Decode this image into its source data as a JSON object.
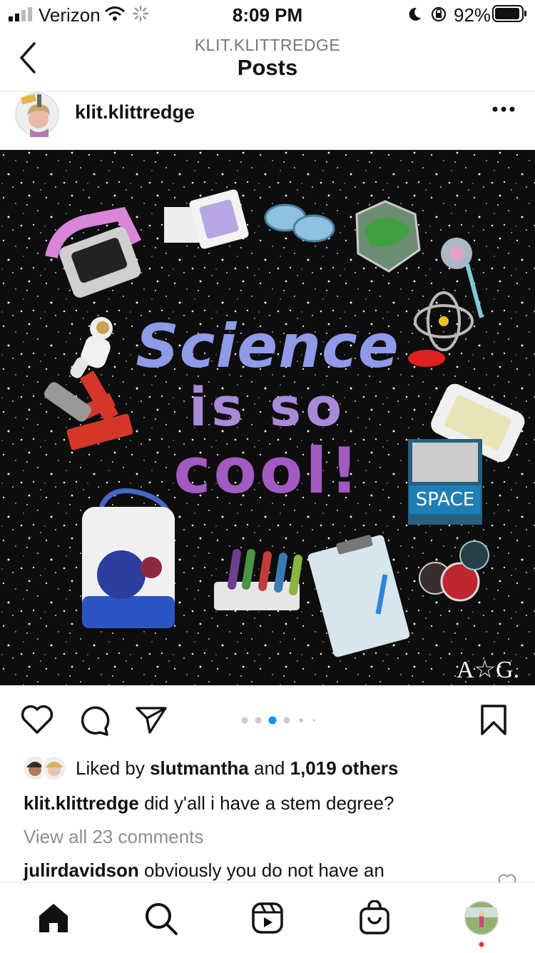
{
  "status_bar": {
    "carrier": "Verizon",
    "time": "8:09 PM",
    "battery": "92%"
  },
  "header": {
    "subtitle": "KLIT.KLITTREDGE",
    "title": "Posts"
  },
  "post": {
    "username": "klit.klittredge",
    "image_text": {
      "line1": "Science",
      "line2": "is so",
      "line3": "cool!",
      "book_title": "SPACE",
      "brand": "A☆G."
    },
    "likes": {
      "prefix": "Liked by",
      "user": "slutmantha",
      "middle": "and",
      "count": "1,019 others"
    },
    "caption": {
      "user": "klit.klittredge",
      "text": "did y'all i have a stem degree?"
    },
    "view_comments": "View all 23 comments",
    "comment": {
      "user": "julirdavidson",
      "text": "obviously you do not have an"
    },
    "carousel": {
      "count": 5,
      "active": 3
    }
  },
  "nav": {
    "items": [
      "home",
      "search",
      "reels",
      "shop",
      "profile"
    ]
  },
  "colors": {
    "accent": "#0095f6",
    "notification": "#ff3040"
  }
}
